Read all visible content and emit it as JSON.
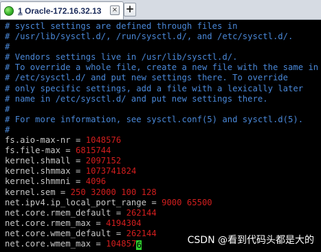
{
  "tab": {
    "number": "1",
    "title": "Oracle-172.16.32.13",
    "close_glyph": "×",
    "add_glyph": "+"
  },
  "colors": {
    "comment": "#4a88d8",
    "value": "#d21e1e",
    "text": "#c8c8c8",
    "cursor": "#2fd12f",
    "background": "#000000"
  },
  "comments": [
    "# sysctl settings are defined through files in",
    "# /usr/lib/sysctl.d/, /run/sysctl.d/, and /etc/sysctl.d/.",
    "#",
    "# Vendors settings live in /usr/lib/sysctl.d/.",
    "# To override a whole file, create a new file with the same in",
    "# /etc/sysctl.d/ and put new settings there. To override",
    "# only specific settings, add a file with a lexically later",
    "# name in /etc/sysctl.d/ and put new settings there.",
    "#",
    "# For more information, see sysctl.conf(5) and sysctl.d(5).",
    "#"
  ],
  "settings": [
    {
      "key": "fs.aio-max-nr",
      "value": "1048576"
    },
    {
      "key": "fs.file-max",
      "value": "6815744"
    },
    {
      "key": "kernel.shmall",
      "value": "2097152"
    },
    {
      "key": "kernel.shmmax",
      "value": "1073741824"
    },
    {
      "key": "kernel.shmmni",
      "value": "4096"
    },
    {
      "key": "kernel.sem",
      "value": "250 32000 100 128"
    },
    {
      "key": "net.ipv4.ip_local_port_range",
      "value": "9000 65500"
    },
    {
      "key": "net.core.rmem_default",
      "value": "262144"
    },
    {
      "key": "net.core.rmem_max",
      "value": "4194304"
    },
    {
      "key": "net.core.wmem_default",
      "value": "262144"
    },
    {
      "key": "net.core.wmem_max",
      "value": "104857",
      "cursor_char": "6"
    }
  ],
  "watermark": "CSDN @看到代码头都是大的"
}
